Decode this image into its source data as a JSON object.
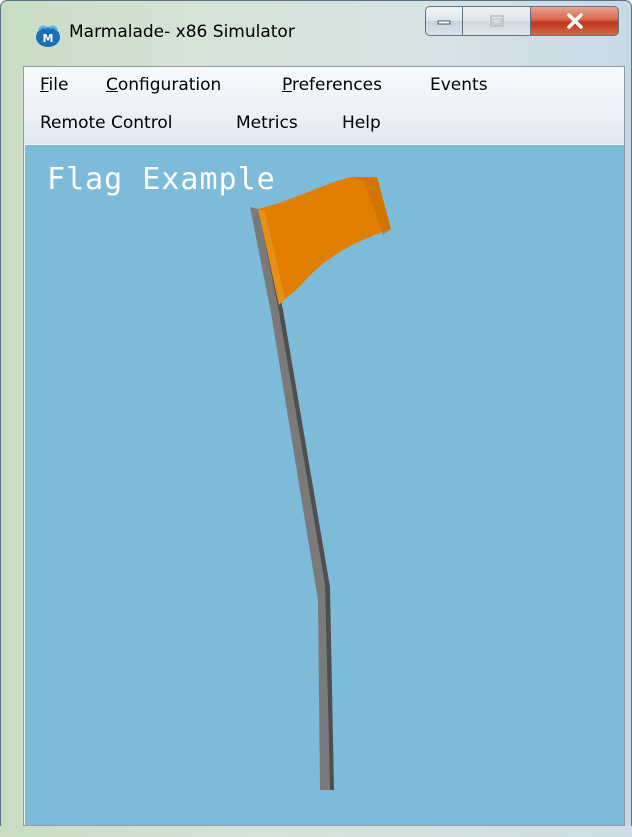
{
  "window": {
    "title": "Marmalade- x86 Simulator",
    "app_icon": "marmalade-logo-icon",
    "controls": {
      "minimize_icon": "minimize-icon",
      "maximize_icon": "maximize-icon",
      "close_icon": "close-icon"
    }
  },
  "menu": {
    "row1": [
      {
        "label": "File",
        "access_key": "F"
      },
      {
        "label": "Configuration",
        "access_key": "C"
      },
      {
        "label": "Preferences",
        "access_key": "P"
      },
      {
        "label": "Events",
        "access_key": ""
      }
    ],
    "row2": [
      {
        "label": "Remote Control",
        "access_key": ""
      },
      {
        "label": "Metrics",
        "access_key": ""
      },
      {
        "label": "Help",
        "access_key": ""
      }
    ]
  },
  "viewport": {
    "title": "Flag Example",
    "background_color": "#7dbbd8",
    "flag_color": "#e17f00",
    "pole_color": "#7a7a7a"
  }
}
